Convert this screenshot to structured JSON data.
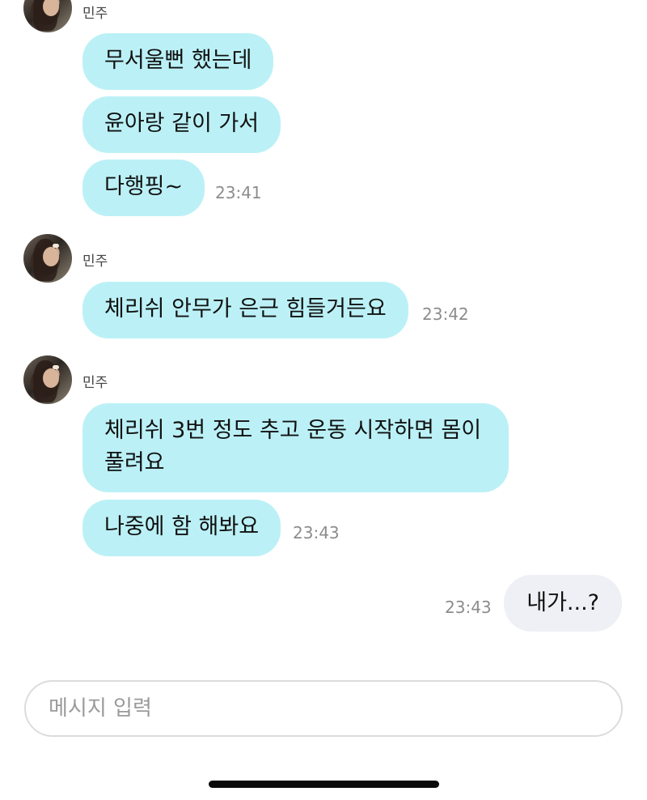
{
  "groups": [
    {
      "sender": "민주",
      "messages": [
        {
          "text": "무서울뻔 했는데"
        },
        {
          "text": "윤아랑 같이 가서"
        },
        {
          "text": "다행핑~",
          "time": "23:41"
        }
      ]
    },
    {
      "sender": "민주",
      "messages": [
        {
          "text": "체리쉬 안무가 은근 힘들거든요",
          "time": "23:42"
        }
      ]
    },
    {
      "sender": "민주",
      "messages": [
        {
          "text": "체리쉬 3번 정도 추고 운동 시작하면 몸이 풀려요"
        },
        {
          "text": "나중에 함 해봐요",
          "time": "23:43"
        }
      ]
    }
  ],
  "my_message": {
    "text": "내가...?",
    "time": "23:43"
  },
  "input": {
    "placeholder": "메시지 입력"
  },
  "colors": {
    "incoming_bubble": "#bbf1f6",
    "outgoing_bubble": "#eef0f5",
    "timestamp": "#8c8c8c"
  }
}
